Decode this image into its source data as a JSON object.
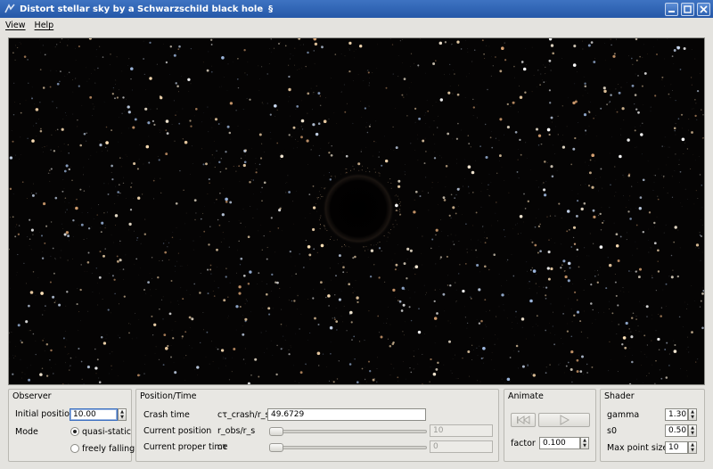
{
  "window": {
    "title": "Distort stellar sky by a Schwarzschild black hole",
    "title_glyph": "§",
    "icons": {
      "app": "app-icon",
      "minimize": "minimize-icon",
      "maximize": "maximize-icon",
      "close": "close-icon"
    }
  },
  "menubar": {
    "items": [
      "View",
      "Help"
    ]
  },
  "observer": {
    "group_title": "Observer",
    "initial_position_label": "Initial position",
    "initial_position_value": "10.00",
    "mode_label": "Mode",
    "mode_options": [
      "quasi-static",
      "freely falling"
    ],
    "mode_selected": "quasi-static"
  },
  "position_time": {
    "group_title": "Position/Time",
    "crash_time_label": "Crash time",
    "crash_time_symbol": "cτ_crash/r_s",
    "crash_time_value": "49.6729",
    "current_position_label": "Current position",
    "current_position_symbol": "r_obs/r_s",
    "current_position_value": "10",
    "current_proper_time_label": "Current proper time",
    "current_proper_time_symbol": "cτ",
    "current_proper_time_value": "0"
  },
  "animate": {
    "group_title": "Animate",
    "factor_label": "factor",
    "factor_value": "0.100",
    "icons": {
      "rewind": "rewind-icon",
      "play": "play-icon"
    }
  },
  "shader": {
    "group_title": "Shader",
    "gamma_label": "gamma",
    "gamma_value": "1.30",
    "s0_label": "s0",
    "s0_value": "0.50",
    "max_point_size_label": "Max point size",
    "max_point_size_value": "10"
  },
  "colors": {
    "title_bar": "#2d63b4",
    "sky_background": "#050404",
    "window_background": "#e4e3df"
  }
}
